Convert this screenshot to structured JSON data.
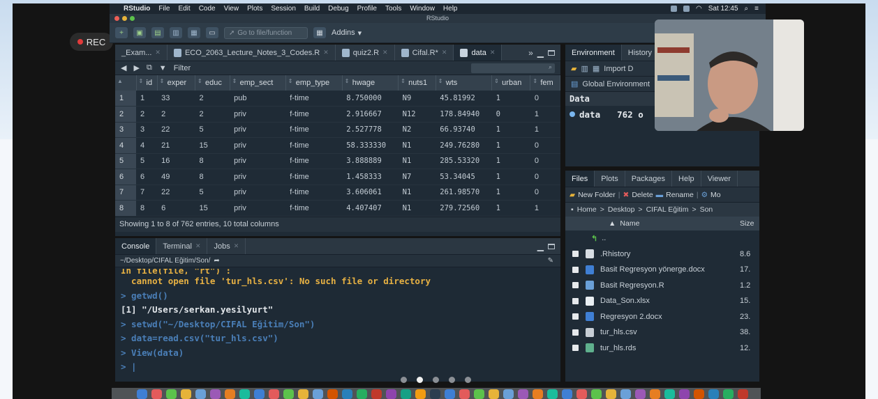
{
  "recording": {
    "label": "REC"
  },
  "menubar": {
    "app": "RStudio",
    "items": [
      "File",
      "Edit",
      "Code",
      "View",
      "Plots",
      "Session",
      "Build",
      "Debug",
      "Profile",
      "Tools",
      "Window",
      "Help"
    ],
    "clock": "Sat 12:45"
  },
  "window": {
    "title": "RStudio"
  },
  "toolbar": {
    "goto_placeholder": "Go to file/function",
    "addins_label": "Addins"
  },
  "source": {
    "tabs": [
      {
        "label": "_Exam..."
      },
      {
        "label": "ECO_2063_Lecture_Notes_3_Codes.R"
      },
      {
        "label": "quiz2.R"
      },
      {
        "label": "Cifal.R*"
      },
      {
        "label": "data"
      }
    ],
    "filter_label": "Filter",
    "columns": [
      "id",
      "exper",
      "educ",
      "emp_sect",
      "emp_type",
      "hwage",
      "nuts1",
      "wts",
      "urban",
      "fem"
    ],
    "rows": [
      {
        "n": "1",
        "id": "1",
        "exper": "33",
        "educ": "2",
        "emp_sect": "pub",
        "emp_type": "f-time",
        "hwage": "8.750000",
        "nuts1": "N9",
        "wts": "45.81992",
        "urban": "1",
        "fem": "0"
      },
      {
        "n": "2",
        "id": "2",
        "exper": "2",
        "educ": "2",
        "emp_sect": "priv",
        "emp_type": "f-time",
        "hwage": "2.916667",
        "nuts1": "N12",
        "wts": "178.84940",
        "urban": "0",
        "fem": "1"
      },
      {
        "n": "3",
        "id": "3",
        "exper": "22",
        "educ": "5",
        "emp_sect": "priv",
        "emp_type": "f-time",
        "hwage": "2.527778",
        "nuts1": "N2",
        "wts": "66.93740",
        "urban": "1",
        "fem": "1"
      },
      {
        "n": "4",
        "id": "4",
        "exper": "21",
        "educ": "15",
        "emp_sect": "priv",
        "emp_type": "f-time",
        "hwage": "58.333330",
        "nuts1": "N1",
        "wts": "249.76280",
        "urban": "1",
        "fem": "0"
      },
      {
        "n": "5",
        "id": "5",
        "exper": "16",
        "educ": "8",
        "emp_sect": "priv",
        "emp_type": "f-time",
        "hwage": "3.888889",
        "nuts1": "N1",
        "wts": "285.53320",
        "urban": "1",
        "fem": "0"
      },
      {
        "n": "6",
        "id": "6",
        "exper": "49",
        "educ": "8",
        "emp_sect": "priv",
        "emp_type": "f-time",
        "hwage": "1.458333",
        "nuts1": "N7",
        "wts": "53.34045",
        "urban": "1",
        "fem": "0"
      },
      {
        "n": "7",
        "id": "7",
        "exper": "22",
        "educ": "5",
        "emp_sect": "priv",
        "emp_type": "f-time",
        "hwage": "3.606061",
        "nuts1": "N1",
        "wts": "261.98570",
        "urban": "1",
        "fem": "0"
      },
      {
        "n": "8",
        "id": "8",
        "exper": "6",
        "educ": "15",
        "emp_sect": "priv",
        "emp_type": "f-time",
        "hwage": "4.407407",
        "nuts1": "N1",
        "wts": "279.72560",
        "urban": "1",
        "fem": "1"
      }
    ],
    "status": "Showing 1 to 8 of 762 entries, 10 total columns"
  },
  "console": {
    "tabs": [
      "Console",
      "Terminal",
      "Jobs"
    ],
    "path": "~/Desktop/CIFAL Eğitim/Son/",
    "lines": [
      {
        "kind": "err",
        "text": "  cannot open file 'tur_hls.csv': No such file or directory"
      },
      {
        "kind": "cmd",
        "text": "> getwd()"
      },
      {
        "kind": "out",
        "text": "[1] \"/Users/serkan.yesilyurt\""
      },
      {
        "kind": "cmd",
        "text": "> setwd(\"~/Desktop/CIFAL Eğitim/Son\")"
      },
      {
        "kind": "cmd",
        "text": "> data=read.csv(\"tur_hls.csv\")"
      },
      {
        "kind": "cmd",
        "text": "> View(data)"
      },
      {
        "kind": "cmd",
        "text": "> |"
      }
    ]
  },
  "environment": {
    "tabs": [
      "Environment",
      "History"
    ],
    "import_label": "Import D",
    "scope": "Global Environment",
    "section": "Data",
    "var_name": "data",
    "var_value": "762 o"
  },
  "files": {
    "tabs": [
      "Files",
      "Plots",
      "Packages",
      "Help",
      "Viewer"
    ],
    "tool_new": "New Folder",
    "tool_delete": "Delete",
    "tool_rename": "Rename",
    "tool_more": "Mo",
    "breadcrumb": [
      "Home",
      "Desktop",
      "CIFAL Eğitim",
      "Son"
    ],
    "header_name": "Name",
    "header_size": "Size",
    "up_label": "..",
    "items": [
      {
        "name": ".Rhistory",
        "size": "8.6",
        "icon": "rhistory-icon",
        "color": "#d7dde3"
      },
      {
        "name": "Basit Regresyon yönerge.docx",
        "size": "17.",
        "icon": "word-doc-icon",
        "color": "#3f7fd4"
      },
      {
        "name": "Basit Regresyon.R",
        "size": "1.2",
        "icon": "r-script-icon",
        "color": "#6aa0d8"
      },
      {
        "name": "Data_Son.xlsx",
        "size": "15.",
        "icon": "file-icon",
        "color": "#e9eef2"
      },
      {
        "name": "Regresyon 2.docx",
        "size": "23.",
        "icon": "word-doc-icon",
        "color": "#3f7fd4"
      },
      {
        "name": "tur_hls.csv",
        "size": "38.",
        "icon": "csv-icon",
        "color": "#c7ced5"
      },
      {
        "name": "tur_hls.rds",
        "size": "12.",
        "icon": "rds-icon",
        "color": "#5fb08d"
      }
    ]
  }
}
